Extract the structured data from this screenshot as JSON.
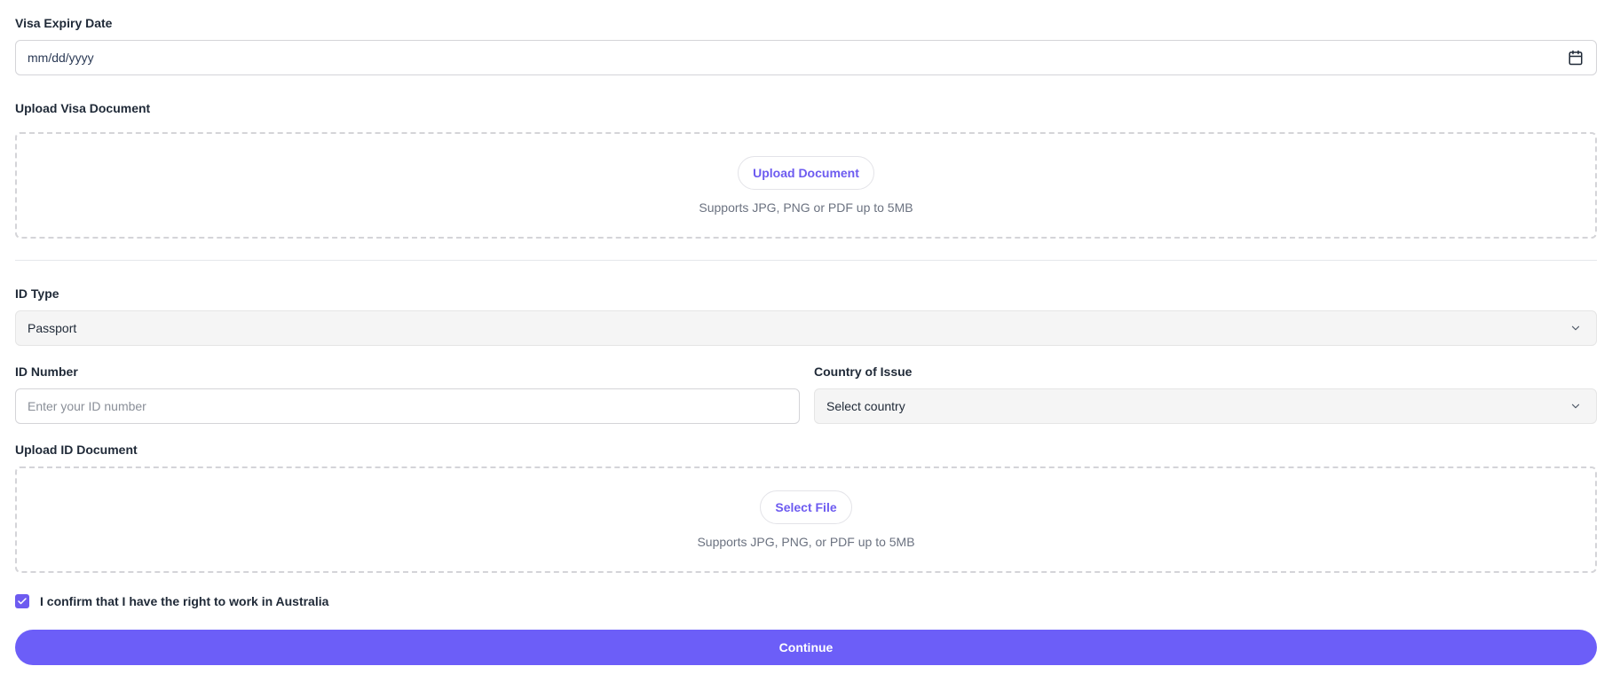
{
  "visa_expiry": {
    "label": "Visa Expiry Date",
    "placeholder": "mm/dd/yyyy",
    "icon": "calendar-icon"
  },
  "visa_upload": {
    "label": "Upload Visa Document",
    "button_label": "Upload Document",
    "hint": "Supports JPG, PNG or PDF up to 5MB"
  },
  "id_type": {
    "label": "ID Type",
    "selected": "Passport",
    "icon": "chevron-down-icon"
  },
  "id_number": {
    "label": "ID Number",
    "placeholder": "Enter your ID number"
  },
  "country_of_issue": {
    "label": "Country of Issue",
    "selected": "Select country",
    "icon": "chevron-down-icon"
  },
  "id_upload": {
    "label": "Upload ID Document",
    "button_label": "Select File",
    "hint": "Supports JPG, PNG, or PDF up to 5MB"
  },
  "right_to_work": {
    "label": "I confirm that I have the right to work in Australia",
    "checked": true
  },
  "continue_label": "Continue",
  "colors": {
    "accent": "#6c5ef8",
    "border": "#d4d4d8",
    "muted_text": "#6b7280"
  }
}
